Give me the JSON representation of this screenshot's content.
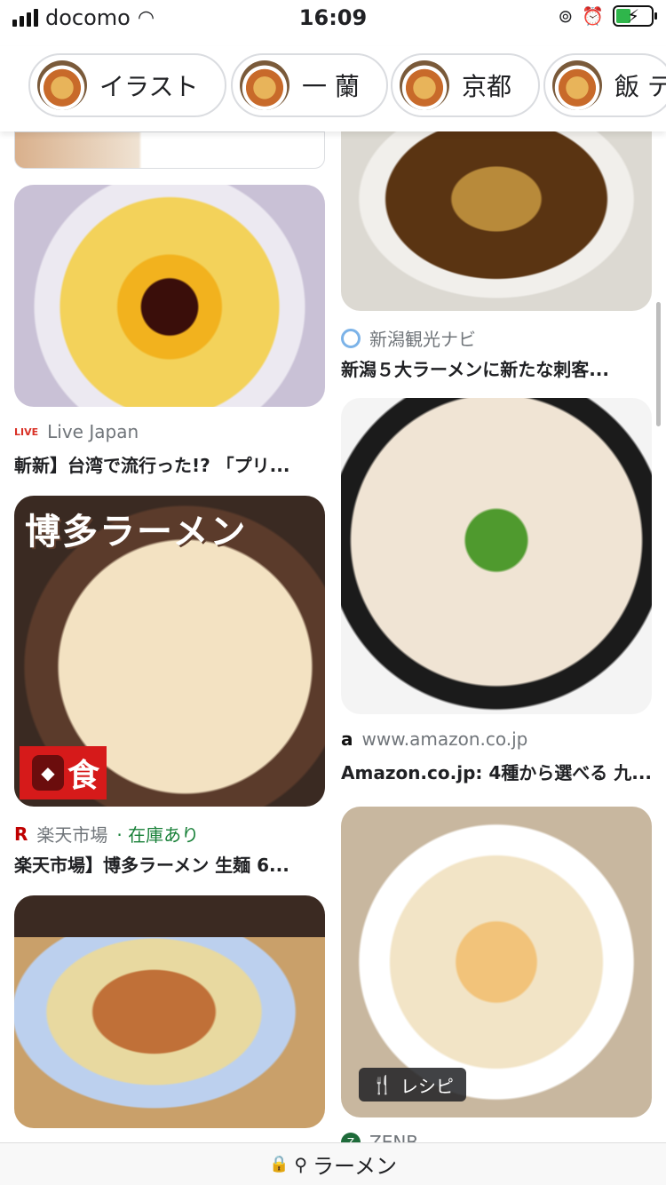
{
  "status_bar": {
    "carrier": "docomo",
    "time": "16:09"
  },
  "chips": [
    {
      "label": "イラスト"
    },
    {
      "label": "一 蘭"
    },
    {
      "label": "京都"
    },
    {
      "label": "飯 テ"
    }
  ],
  "results_left": [
    {
      "source": "Live Japan",
      "source_badge": "LIVE",
      "title": "斬新】台湾で流行った!? 「プリ..."
    },
    {
      "source": "楽天市場",
      "stock": "· 在庫あり",
      "title": "楽天市場】博多ラーメン 生麺 6...",
      "overlay_text": "博多ラーメン",
      "badge": "食"
    },
    {
      "source": "",
      "title": ""
    }
  ],
  "results_right": [
    {
      "source": "新潟観光ナビ",
      "title": "新潟５大ラーメンに新たな刺客..."
    },
    {
      "source": "www.amazon.co.jp",
      "title": "Amazon.co.jp: 4種から選べる 九..."
    },
    {
      "source": "ZENB",
      "badge": "レシピ"
    }
  ],
  "bottom_bar": {
    "query": "ラーメン"
  },
  "colors": {
    "accent_green": "#188038",
    "rakuten_red": "#bf0000"
  }
}
